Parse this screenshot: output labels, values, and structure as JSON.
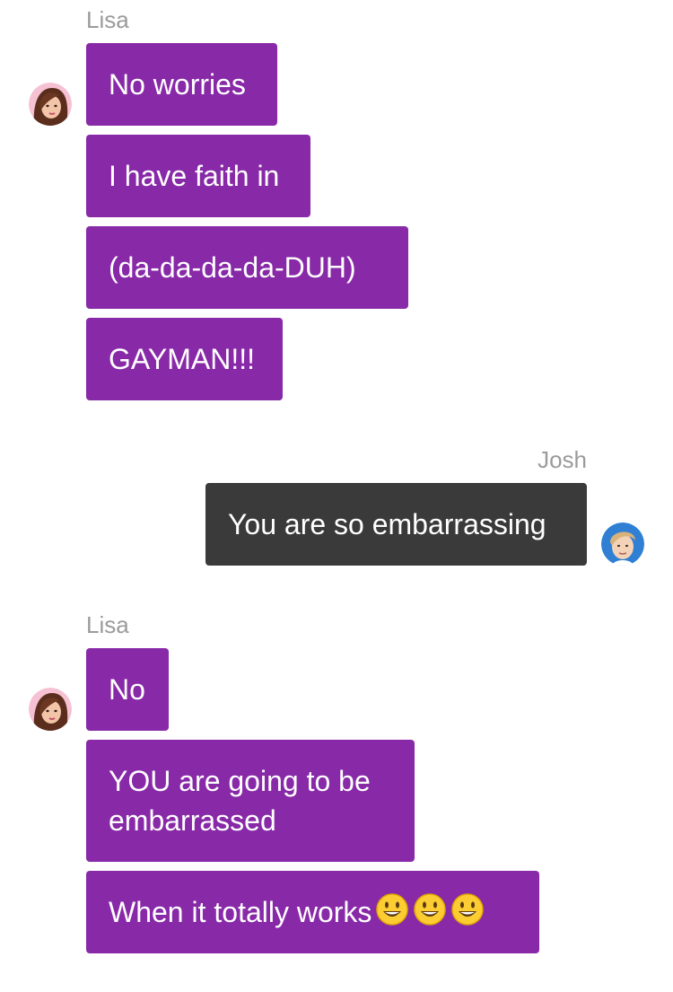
{
  "thread": {
    "group1": {
      "sender": "Lisa",
      "messages": [
        "No worries",
        "I have faith in",
        "(da-da-da-da-DUH)",
        "GAYMAN!!!"
      ]
    },
    "group2": {
      "sender": "Josh",
      "messages": [
        "You are so embarrassing"
      ]
    },
    "group3": {
      "sender": "Lisa",
      "messages": [
        "No",
        "YOU are going to be",
        "embarrassed",
        "When it totally works"
      ]
    }
  },
  "colors": {
    "incoming_bubble": "#8829a8",
    "outgoing_bubble": "#3a3a3a",
    "sender_name": "#9b9b9b"
  },
  "icons": [
    "lisa-avatar-icon",
    "josh-avatar-icon",
    "smiley-emoji-icon"
  ]
}
